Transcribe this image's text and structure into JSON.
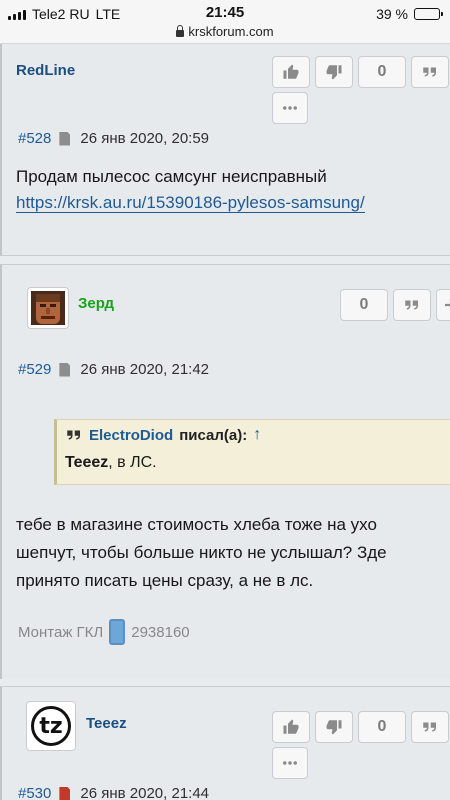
{
  "status_bar": {
    "carrier": "Tele2 RU",
    "network": "LTE",
    "time": "21:45",
    "battery": "39 %",
    "battery_level": 0.39,
    "url": "krskforum.com"
  },
  "posts": [
    {
      "username": "RedLine",
      "buttons": {
        "like_icon": "thumbs-up-icon",
        "dislike_icon": "thumbs-down-icon",
        "score": "0",
        "quote_icon": "quote-icon",
        "more_icon": "more-icon"
      },
      "number": "#528",
      "date": "26 янв 2020, 20:59",
      "text": "Продам пылесос самсунг неисправный",
      "link": "https://krsk.au.ru/15390186-pylesos-samsung/"
    },
    {
      "username": "Зерд",
      "username_color": "#1aa21a",
      "buttons": {
        "score": "0",
        "quote_icon": "quote-icon",
        "plus_icon": "plus-icon"
      },
      "number": "#529",
      "date": "26 янв 2020, 21:42",
      "quote": {
        "author": "ElectroDiod",
        "said": "писал(а):",
        "arrow": "↑",
        "text_bold": "Teeez",
        "text_rest": ", в ЛС."
      },
      "text_lines": [
        "тебе в магазине стоимость хлеба тоже на ухо",
        "шепчут, чтобы больше никто не услышал? Зде",
        "принято писать цены сразу, а не в лс."
      ],
      "signature": {
        "label": "Монтаж ГКЛ",
        "icon": "phone-icon",
        "number": "2938160"
      }
    },
    {
      "username": "Teeez",
      "avatar_text": "tz",
      "buttons": {
        "score": "0"
      },
      "number": "#530",
      "date": "26 янв 2020, 21:44"
    }
  ]
}
